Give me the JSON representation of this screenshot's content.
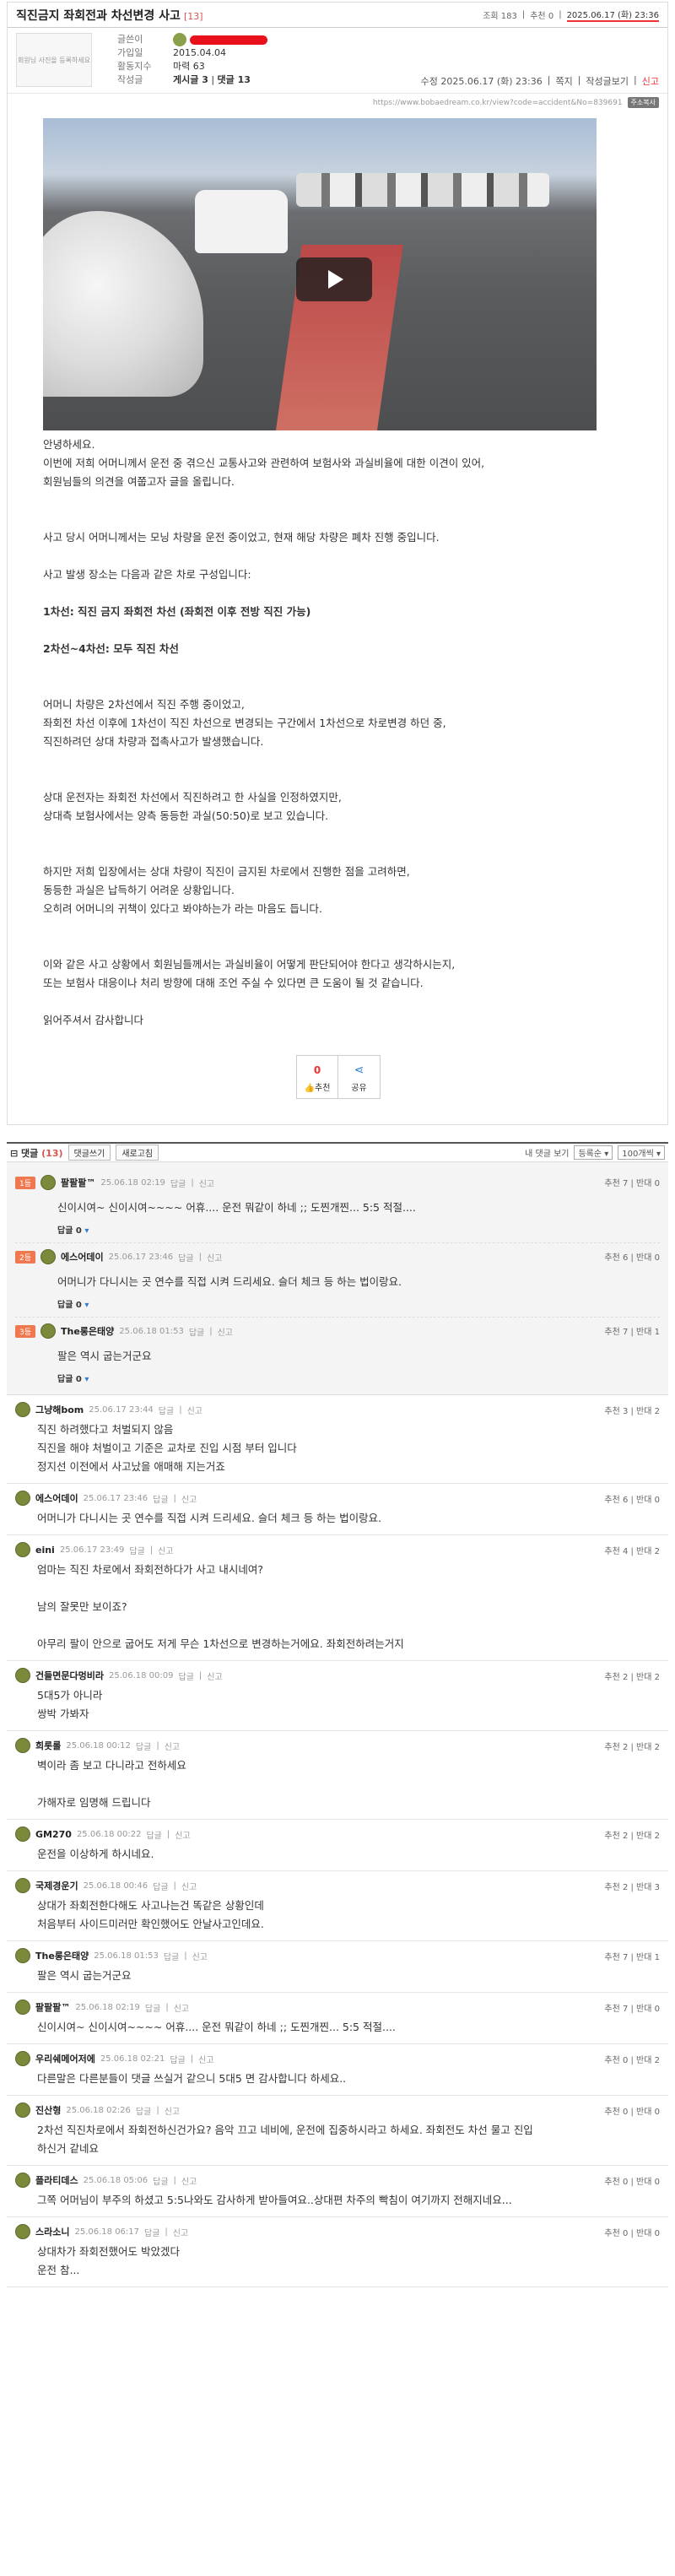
{
  "post": {
    "title": "직진금지 좌회전과 차선변경 사고",
    "comment_count_badge": "[13]",
    "views": "조회 183",
    "recommends": "추천 0",
    "date_top": "2025.06.17 (화) 23:36",
    "author_photo_text": "회원님 사진을 등록하세요",
    "author_labels": [
      "글쓴이",
      "가입일",
      "활동지수",
      "작성글"
    ],
    "join_date": "2015.04.04",
    "activity": "마력 63",
    "posts_count": "게시글 3",
    "comments_count": "댓글 13",
    "modified": "수정 2025.06.17 (화) 23:36",
    "actions": [
      "쪽지",
      "작성글보기",
      "신고"
    ],
    "url": "https://www.bobaedream.co.kr/view?code=accident&No=839691",
    "url_copy": "주소복사"
  },
  "content": [
    {
      "t": "안녕하세요.",
      "b": false
    },
    {
      "t": "이번에 저희 어머니께서 운전 중 겪으신 교통사고와 관련하여 보험사와 과실비율에 대한 이견이 있어,",
      "b": false
    },
    {
      "t": "회원님들의 의견을 여쭙고자 글을 올립니다.",
      "b": false
    },
    {
      "t": "",
      "b": false
    },
    {
      "t": "",
      "b": false
    },
    {
      "t": "사고 당시 어머니께서는 모닝 차량을 운전 중이었고, 현재 해당 차량은 폐차 진행 중입니다.",
      "b": false
    },
    {
      "t": "",
      "b": false
    },
    {
      "t": "사고 발생 장소는 다음과 같은 차로 구성입니다:",
      "b": false
    },
    {
      "t": "",
      "b": false
    },
    {
      "t": "1차선: 직진 금지 좌회전 차선 (좌회전 이후 전방 직진 가능)",
      "b": true
    },
    {
      "t": "",
      "b": false
    },
    {
      "t": "2차선~4차선: 모두 직진 차선",
      "b": true
    },
    {
      "t": "",
      "b": false
    },
    {
      "t": "",
      "b": false
    },
    {
      "t": "어머니 차량은 2차선에서 직진 주행 중이었고,",
      "b": false
    },
    {
      "t": "좌회전 차선 이후에 1차선이 직진 차선으로 변경되는 구간에서 1차선으로 차로변경 하던 중,",
      "b": false
    },
    {
      "t": "직진하려던 상대 차량과 접촉사고가 발생했습니다.",
      "b": false
    },
    {
      "t": "",
      "b": false
    },
    {
      "t": "",
      "b": false
    },
    {
      "t": "상대 운전자는 좌회전 차선에서 직진하려고 한 사실을 인정하였지만,",
      "b": false
    },
    {
      "t": "상대측 보험사에서는 양측 동등한 과실(50:50)로 보고 있습니다.",
      "b": false
    },
    {
      "t": "",
      "b": false
    },
    {
      "t": "",
      "b": false
    },
    {
      "t": "하지만 저희 입장에서는 상대 차량이 직진이 금지된 차로에서 진행한 점을 고려하면,",
      "b": false
    },
    {
      "t": "동등한 과실은 납득하기 어려운 상황입니다.",
      "b": false
    },
    {
      "t": "오히려 어머니의 귀책이 있다고 봐야하는가 라는 마음도 듭니다.",
      "b": false
    },
    {
      "t": "",
      "b": false
    },
    {
      "t": "",
      "b": false
    },
    {
      "t": "이와 같은 사고 상황에서 회원님들께서는 과실비율이 어떻게 판단되어야 한다고 생각하시는지,",
      "b": false
    },
    {
      "t": "또는 보험사 대응이나 처리 방향에 대해 조언 주실 수 있다면 큰 도움이 될 것 같습니다.",
      "b": false
    },
    {
      "t": "",
      "b": false
    },
    {
      "t": "읽어주셔서 감사합니다",
      "b": false
    }
  ],
  "vote": {
    "count": "0",
    "label": "추천",
    "share": "공유"
  },
  "comments_header": {
    "title": "댓글",
    "count": "(13)",
    "btn1": "댓글쓰기",
    "btn2": "새로고침",
    "my_view": "내 댓글 보기",
    "sort": "등록순",
    "per_page": "100개씩"
  },
  "best": [
    {
      "badge": "1등",
      "nick": "팔팔팔™",
      "date": "25.06.18 02:19",
      "votes": "추천 7 | 반대 0",
      "text": "신이시여~ 신이시여~~~~ 어휴.... 운전 뭐같이 하네 ;; 도찐개찐... 5:5 적절...."
    },
    {
      "badge": "2등",
      "nick": "에스어데이",
      "date": "25.06.17 23:46",
      "votes": "추천 6 | 반대 0",
      "text": "어머니가 다니시는 곳 연수를 직접 시켜 드리세요. 슬더 체크 등 하는 법이랑요."
    },
    {
      "badge": "3등",
      "nick": "The롱은태양",
      "date": "25.06.18 01:53",
      "votes": "추천 7 | 반대 1",
      "text": "팔은 역시 굽는거군요"
    }
  ],
  "comment_actions": {
    "reply": "답글",
    "report": "신고",
    "reply_link": "답글 0"
  },
  "comments": [
    {
      "nick": "그냥해bom",
      "date": "25.06.17 23:44",
      "votes": "추천 3 | 반대 2",
      "lines": [
        "직진 하려했다고 처벌되지 않음",
        "직진을 해야 처벌이고 기준은 교차로 진입 시점 부터 입니다",
        "정지선 이전에서 사고났을 애매해 지는거죠"
      ]
    },
    {
      "nick": "에스어데이",
      "date": "25.06.17 23:46",
      "votes": "추천 6 | 반대 0",
      "lines": [
        "어머니가 다니시는 곳 연수를 직접 시켜 드리세요. 슬더 체크 등 하는 법이랑요."
      ]
    },
    {
      "nick": "eini",
      "date": "25.06.17 23:49",
      "votes": "추천 4 | 반대 2",
      "lines": [
        "엄마는 직진 차로에서 좌회전하다가 사고 내시네여?",
        "",
        "남의 잘못만 보이죠?",
        "",
        "아무리 팔이 안으로 굽어도 저게 무슨 1차선으로 변경하는거에요. 좌회전하려는거지"
      ]
    },
    {
      "nick": "건들면문다멍비라",
      "date": "25.06.18 00:09",
      "votes": "추천 2 | 반대 2",
      "lines": [
        "5대5가 아니라",
        "쌍박 가봐자"
      ]
    },
    {
      "nick": "희롯롤",
      "date": "25.06.18 00:12",
      "votes": "추천 2 | 반대 2",
      "lines": [
        "벽이라 좀 보고 다니라고 전하세요",
        "",
        "가해자로 임명해 드립니다"
      ]
    },
    {
      "nick": "GM270",
      "date": "25.06.18 00:22",
      "votes": "추천 2 | 반대 2",
      "lines": [
        "운전을 이상하게 하시네요."
      ]
    },
    {
      "nick": "국제경운기",
      "date": "25.06.18 00:46",
      "votes": "추천 2 | 반대 3",
      "lines": [
        "상대가 좌회전한다해도 사고나는건 똑같은 상황인데",
        "처음부터 사이드미러만 확인했어도 안날사고인데요."
      ]
    },
    {
      "nick": "The롱은태양",
      "date": "25.06.18 01:53",
      "votes": "추천 7 | 반대 1",
      "lines": [
        "팔은 역시 굽는거군요"
      ]
    },
    {
      "nick": "팔팔팔™",
      "date": "25.06.18 02:19",
      "votes": "추천 7 | 반대 0",
      "lines": [
        "신이시여~ 신이시여~~~~ 어휴.... 운전 뭐같이 하네 ;; 도찐개찐... 5:5 적절...."
      ]
    },
    {
      "nick": "우리쉐메어저에",
      "date": "25.06.18 02:21",
      "votes": "추천 0 | 반대 2",
      "lines": [
        "다른말은 다른분들이 댓글 쓰실거 같으니 5대5 면 감사합니다 하세요.."
      ]
    },
    {
      "nick": "진산형",
      "date": "25.06.18 02:26",
      "votes": "추천 0 | 반대 0",
      "lines": [
        "2차선 직진차로에서 좌회전하신건가요? 음악 끄고 네비에, 운전에 집중하시라고 하세요. 좌회전도 차선 물고 진입",
        "하신거 같네요"
      ]
    },
    {
      "nick": "플라티데스",
      "date": "25.06.18 05:06",
      "votes": "추천 0 | 반대 0",
      "lines": [
        "그쪽 어머님이 부주의 하셨고 5:5나와도 감사하게 받아들여요..상대편 차주의 빡침이 여기까지 전해지네요..."
      ]
    },
    {
      "nick": "스라소니",
      "date": "25.06.18 06:17",
      "votes": "추천 0 | 반대 0",
      "lines": [
        "상대차가 좌회전했어도 박았겠다",
        "운전 참..."
      ]
    }
  ]
}
